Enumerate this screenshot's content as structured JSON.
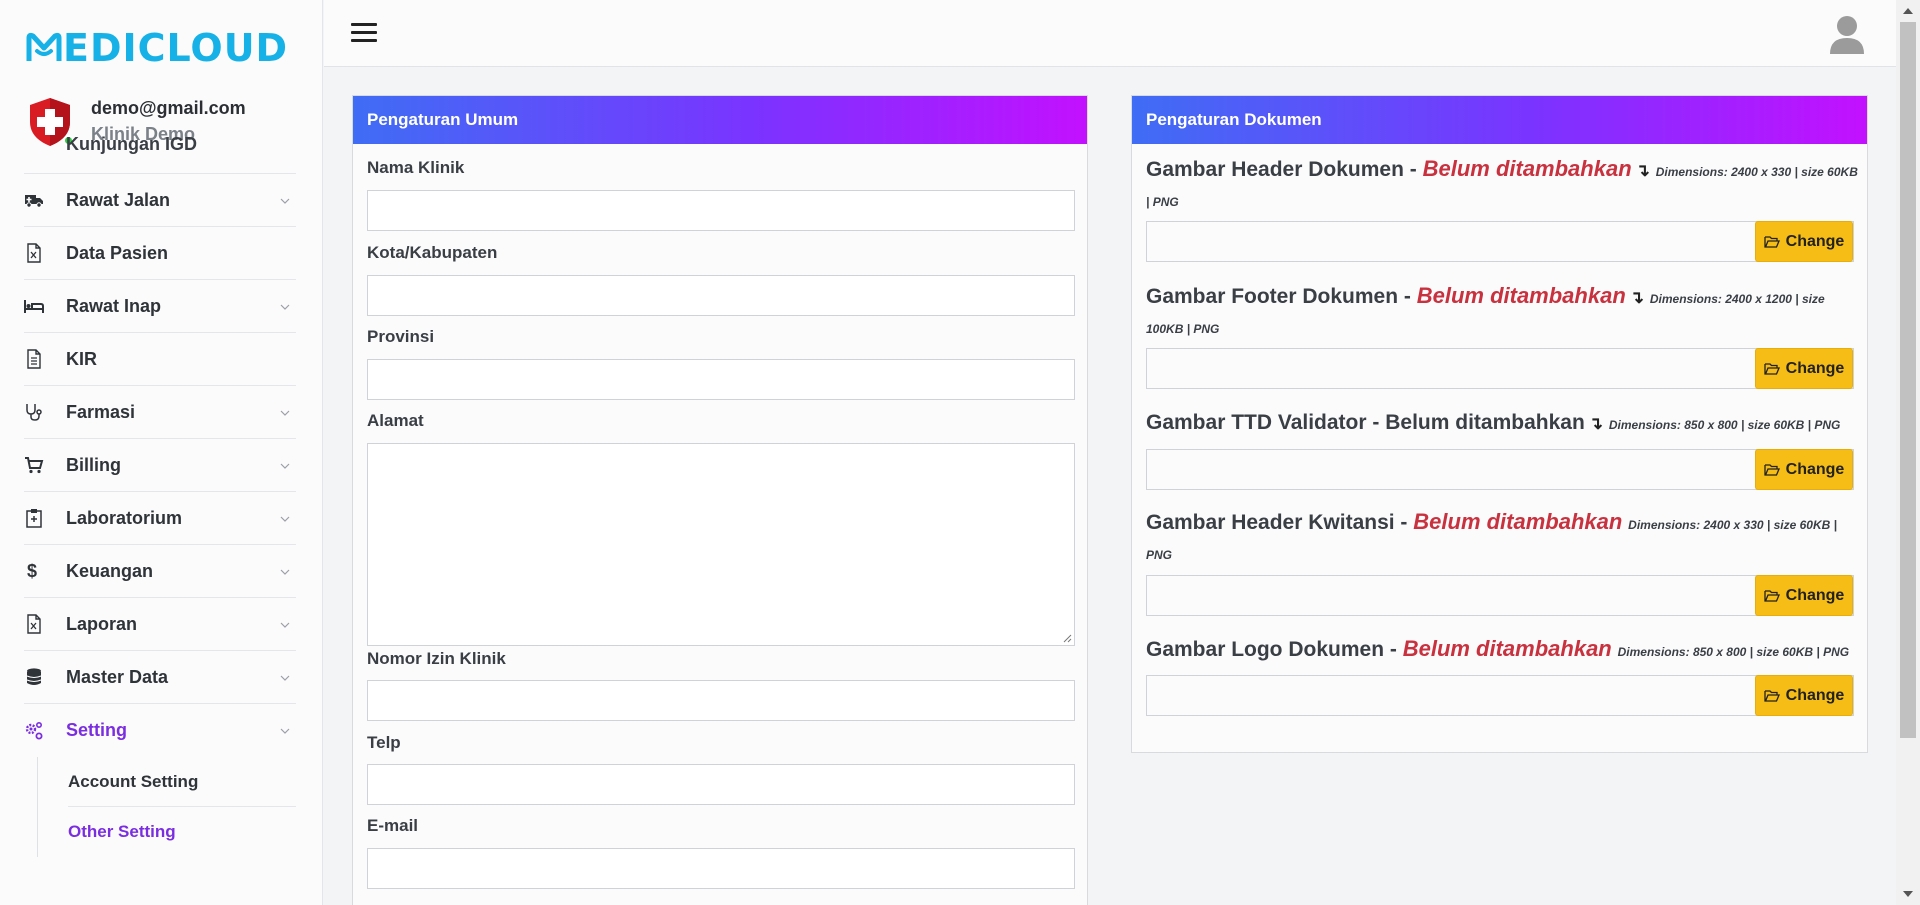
{
  "brand": {
    "name": "EDICLOUD"
  },
  "user": {
    "email": "demo@gmail.com",
    "clinic": "Klinik Demo"
  },
  "sidebar": {
    "cut_item": "Kunjungan IGD",
    "items": [
      {
        "label": "Rawat Jalan",
        "icon": "ambulance-icon"
      },
      {
        "label": "Data Pasien",
        "icon": "document-icon"
      },
      {
        "label": "Rawat Inap",
        "icon": "bed-icon"
      },
      {
        "label": "KIR",
        "icon": "file-text-icon"
      },
      {
        "label": "Farmasi",
        "icon": "stethoscope-icon"
      },
      {
        "label": "Billing",
        "icon": "cart-icon"
      },
      {
        "label": "Laboratorium",
        "icon": "clipboard-icon"
      },
      {
        "label": "Keuangan",
        "icon": "dollar-icon"
      },
      {
        "label": "Laporan",
        "icon": "document-icon"
      },
      {
        "label": "Master Data",
        "icon": "database-icon"
      },
      {
        "label": "Setting",
        "icon": "cogs-icon"
      }
    ],
    "submenu": [
      "Account Setting",
      "Other Setting"
    ]
  },
  "general": {
    "header": "Pengaturan Umum",
    "fields": {
      "nama_klinik": {
        "label": "Nama Klinik",
        "value": ""
      },
      "kota": {
        "label": "Kota/Kabupaten",
        "value": ""
      },
      "provinsi": {
        "label": "Provinsi",
        "value": ""
      },
      "alamat": {
        "label": "Alamat",
        "value": ""
      },
      "izin": {
        "label": "Nomor Izin Klinik",
        "value": ""
      },
      "telp": {
        "label": "Telp",
        "value": ""
      },
      "email": {
        "label": "E-mail",
        "value": ""
      }
    }
  },
  "documents": {
    "header": "Pengaturan Dokumen",
    "button_label": "Change",
    "items": [
      {
        "title": "Gambar Header Dokumen -",
        "status": "Belum ditambahkan",
        "arrow": "↴",
        "dims": "Dimensions: 2400 x 330 | size 60KB | PNG"
      },
      {
        "title": "Gambar Footer Dokumen -",
        "status": "Belum ditambahkan",
        "arrow": "↴",
        "dims": "Dimensions: 2400 x 1200 | size 100KB | PNG"
      },
      {
        "title": "Gambar TTD Validator -",
        "status": "Belum ditambahkan",
        "arrow": "↴",
        "dims": "Dimensions: 850 x 800 | size 60KB | PNG"
      },
      {
        "title": "Gambar Header Kwitansi -",
        "status": "Belum ditambahkan",
        "arrow": "",
        "dims": "Dimensions: 2400 x 330 | size 60KB | PNG"
      },
      {
        "title": "Gambar Logo Dokumen -",
        "status": "Belum ditambahkan",
        "arrow": "",
        "dims": "Dimensions: 850 x 800 | size 60KB | PNG"
      }
    ]
  },
  "colors": {
    "brand": "#16b1e6",
    "accent": "#7a2ee0",
    "warning": "#f6bd16",
    "danger": "#c8323f"
  }
}
